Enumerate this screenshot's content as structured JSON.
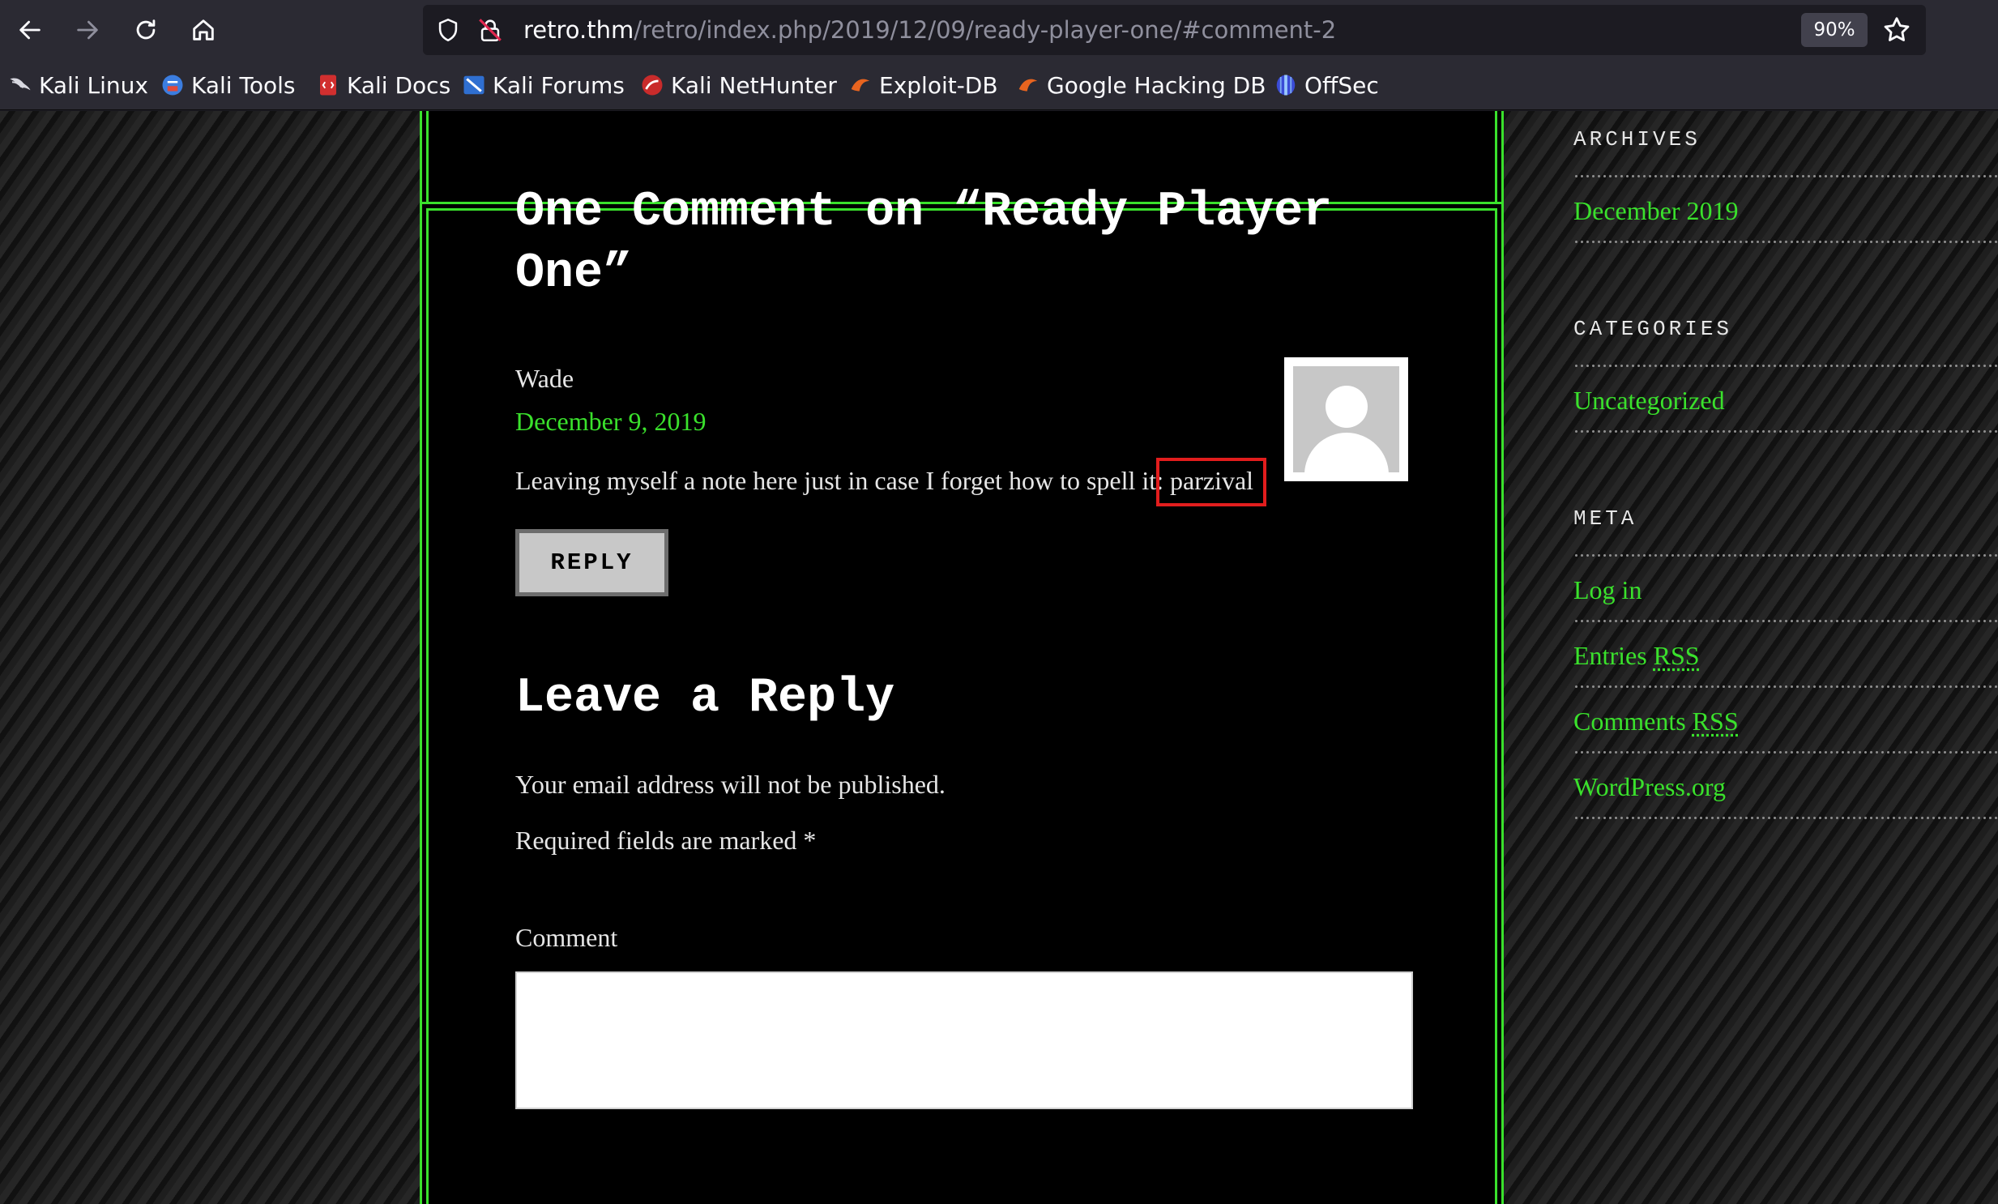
{
  "browser": {
    "url_host": "retro.thm",
    "url_path": "/retro/index.php/2019/12/09/ready-player-one/#comment-2",
    "zoom": "90%",
    "bookmarks": [
      {
        "label": "Kali Linux",
        "icon": "kali-dragon-icon"
      },
      {
        "label": "Kali Tools",
        "icon": "kali-tools-icon"
      },
      {
        "label": "Kali Docs",
        "icon": "kali-docs-icon"
      },
      {
        "label": "Kali Forums",
        "icon": "kali-forums-icon"
      },
      {
        "label": "Kali NetHunter",
        "icon": "kali-nethunter-icon"
      },
      {
        "label": "Exploit-DB",
        "icon": "exploit-db-icon"
      },
      {
        "label": "Google Hacking DB",
        "icon": "ghdb-icon"
      },
      {
        "label": "OffSec",
        "icon": "offsec-icon"
      }
    ]
  },
  "comments": {
    "title": "One Comment on “Ready Player One”",
    "author": "Wade",
    "date": "December 9, 2019",
    "body": "Leaving myself a note here just in case I forget how to spell it:",
    "highlighted_word": "parzival",
    "reply_label": "REPLY"
  },
  "reply_form": {
    "title": "Leave a Reply",
    "email_note": "Your email address will not be published.",
    "required_note": "Required fields are marked *",
    "comment_label": "Comment"
  },
  "sidebar": {
    "archives": {
      "title": "ARCHIVES",
      "links": [
        "December 2019"
      ]
    },
    "categories": {
      "title": "CATEGORIES",
      "links": [
        "Uncategorized"
      ]
    },
    "meta": {
      "title": "META",
      "log_in": "Log in",
      "entries": "Entries",
      "comments": "Comments",
      "rss": "RSS",
      "wordpress": "WordPress.org"
    }
  },
  "colors": {
    "accent_green": "#3ae12c",
    "highlight_red": "#e21d1d"
  }
}
